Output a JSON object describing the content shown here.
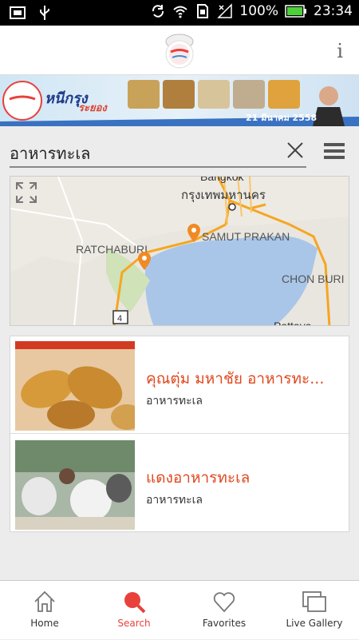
{
  "status_bar": {
    "battery": "100%",
    "time": "23:34"
  },
  "banner": {
    "title": "หนีกรุง",
    "subtitle": "ระยอง",
    "date": "21 มีนาคม 2558"
  },
  "search": {
    "value": "อาหารทะเล"
  },
  "map": {
    "labels": {
      "bangkok_en": "Bangkok",
      "bangkok_th": "กรุงเทพมหานคร",
      "samut_prakan": "SAMUT PRAKAN",
      "ratchaburi": "RATCHABURI",
      "chon_buri": "CHON BURI",
      "pattaya": "Pattaya",
      "route_4": "4"
    }
  },
  "results": [
    {
      "title": "คุณตุ่ม มหาชัย อาหารทะ...",
      "category": "อาหารทะเล"
    },
    {
      "title": "แดงอาหารทะเล",
      "category": "อาหารทะเล"
    }
  ],
  "tabs": [
    {
      "label": "Home",
      "icon": "home-icon"
    },
    {
      "label": "Search",
      "icon": "search-icon"
    },
    {
      "label": "Favorites",
      "icon": "heart-icon"
    },
    {
      "label": "Live Gallery",
      "icon": "gallery-icon"
    }
  ],
  "colors": {
    "accent": "#e8413c",
    "result_title": "#e0481e",
    "map_water": "#a9c6e8",
    "map_road": "#f5a623"
  }
}
